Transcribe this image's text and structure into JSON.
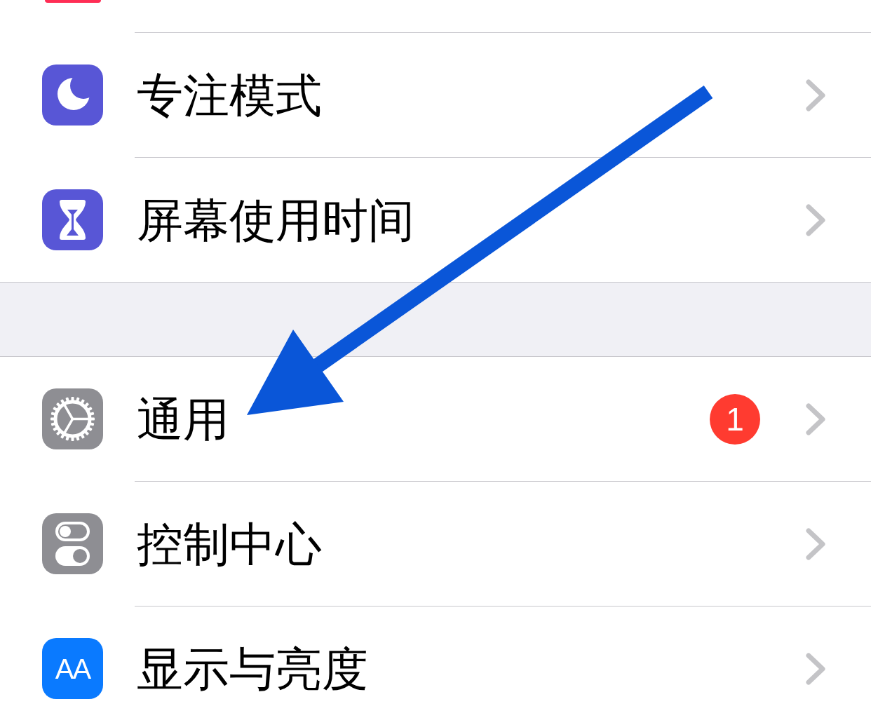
{
  "groups": [
    {
      "rows": [
        {
          "kind": "moon",
          "label": "专注模式"
        },
        {
          "kind": "hourglass",
          "label": "屏幕使用时间"
        }
      ]
    },
    {
      "rows": [
        {
          "kind": "gear",
          "label": "通用",
          "badge": "1"
        },
        {
          "kind": "switches",
          "label": "控制中心"
        },
        {
          "kind": "text_size",
          "icon_text": "AA",
          "label": "显示与亮度"
        }
      ]
    }
  ]
}
